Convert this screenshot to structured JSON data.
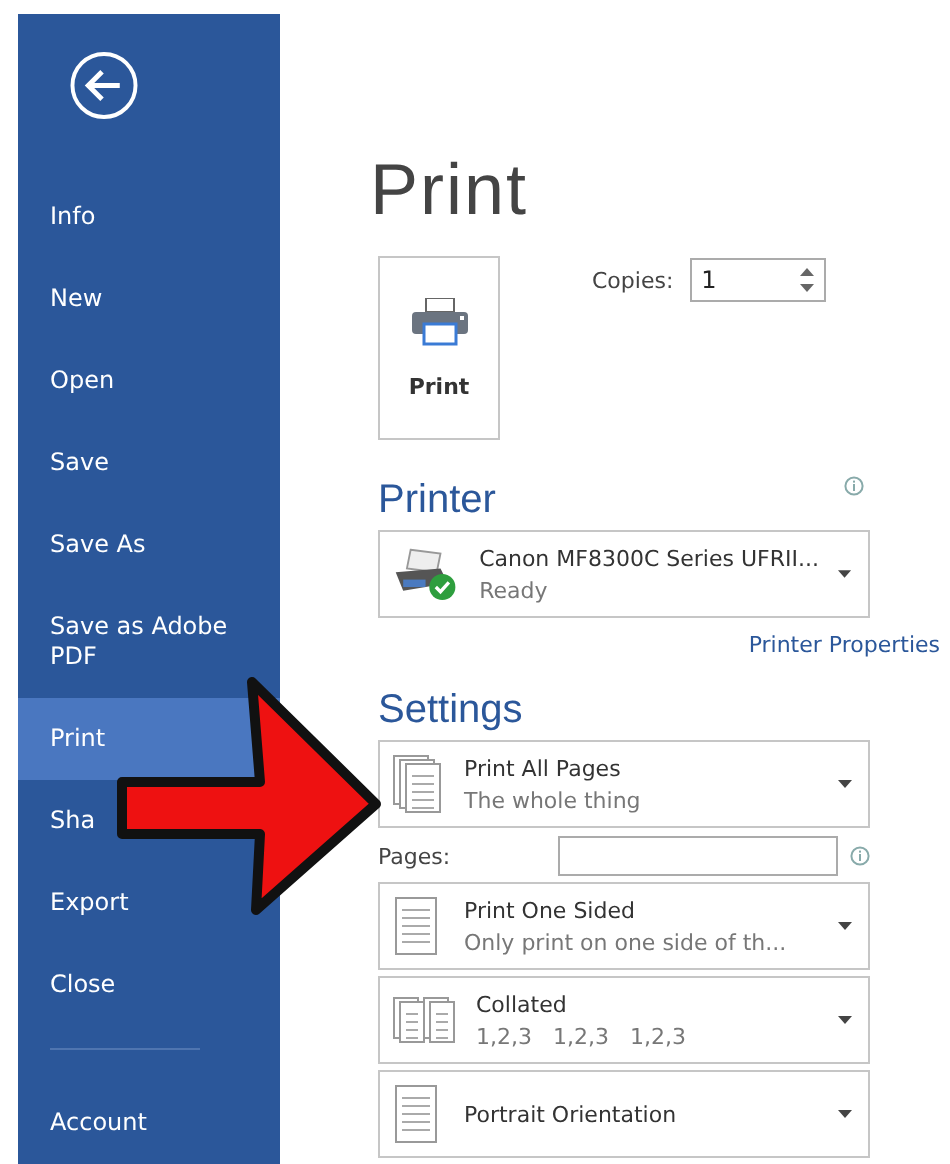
{
  "sidebar": {
    "items": [
      {
        "label": "Info",
        "selected": false
      },
      {
        "label": "New",
        "selected": false
      },
      {
        "label": "Open",
        "selected": false
      },
      {
        "label": "Save",
        "selected": false
      },
      {
        "label": "Save As",
        "selected": false
      },
      {
        "label": "Save as Adobe PDF",
        "selected": false
      },
      {
        "label": "Print",
        "selected": true
      },
      {
        "label": "Sha",
        "selected": false
      },
      {
        "label": "Export",
        "selected": false
      },
      {
        "label": "Close",
        "selected": false
      }
    ],
    "footer_items": [
      {
        "label": "Account",
        "selected": false
      }
    ]
  },
  "title": "Print",
  "print_button": {
    "label": "Print"
  },
  "copies": {
    "label": "Copies:",
    "value": "1"
  },
  "printer": {
    "heading": "Printer",
    "name": "Canon MF8300C Series UFRII...",
    "status": "Ready",
    "properties_link": "Printer Properties"
  },
  "settings": {
    "heading": "Settings",
    "rows": [
      {
        "kind": "scope",
        "title": "Print All Pages",
        "subtitle": "The whole thing"
      },
      {
        "kind": "pages",
        "label": "Pages:"
      },
      {
        "kind": "sides",
        "title": "Print One Sided",
        "subtitle": "Only print on one side of th..."
      },
      {
        "kind": "collation",
        "title": "Collated",
        "subtitle": "1,2,3   1,2,3   1,2,3"
      },
      {
        "kind": "orientation",
        "title": "Portrait Orientation"
      }
    ]
  }
}
